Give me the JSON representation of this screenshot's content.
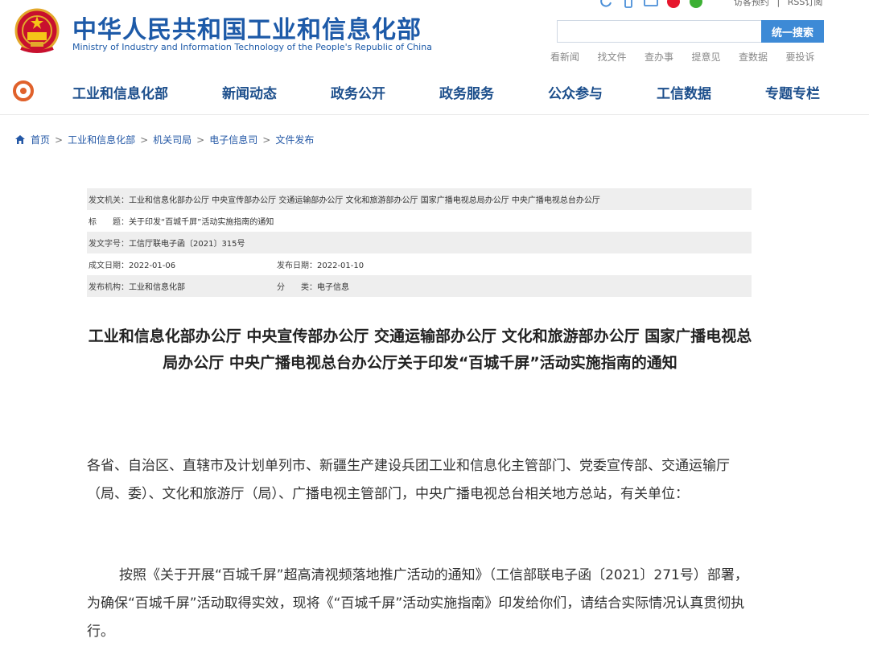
{
  "header": {
    "title": "中华人民共和国工业和信息化部",
    "subtitle": "Ministry of Industry and Information Technology of the People's Republic of China",
    "top_links": [
      "访客预约",
      "|",
      "RSS订阅"
    ],
    "search": {
      "placeholder": "",
      "button_label": "统一搜索"
    },
    "quick_links": [
      "看新闻",
      "找文件",
      "查办事",
      "提意见",
      "查数据",
      "要投诉"
    ]
  },
  "nav": {
    "items": [
      "工业和信息化部",
      "新闻动态",
      "政务公开",
      "政务服务",
      "公众参与",
      "工信数据",
      "专题专栏"
    ]
  },
  "breadcrumb": [
    "首页",
    "工业和信息化部",
    "机关司局",
    "电子信息司",
    "文件发布"
  ],
  "meta": {
    "issuer_label": "发文机关：",
    "issuer": "工业和信息化部办公厅 中央宣传部办公厅 交通运输部办公厅 文化和旅游部办公厅 国家广播电视总局办公厅 中央广播电视总台办公厅",
    "title_label": "标　　题：",
    "title": "关于印发“百城千屏”活动实施指南的通知",
    "docno_label": "发文字号：",
    "docno": "工信厅联电子函〔2021〕315号",
    "created_label": "成文日期：",
    "created": "2022-01-06",
    "published_label": "发布日期：",
    "published": "2022-01-10",
    "org_label": "发布机构：",
    "org": "工业和信息化部",
    "category_label": "分　　类：",
    "category": "电子信息"
  },
  "document": {
    "title": "工业和信息化部办公厅 中央宣传部办公厅 交通运输部办公厅 文化和旅游部办公厅 国家广播电视总局办公厅 中央广播电视总台办公厅关于印发“百城千屏”活动实施指南的通知",
    "salutation": "各省、自治区、直辖市及计划单列市、新疆生产建设兵团工业和信息化主管部门、党委宣传部、交通运输厅（局、委）、文化和旅游厅（局）、广播电视主管部门，中央广播电视总台相关地方总站，有关单位：",
    "paragraph1": "按照《关于开展“百城千屏”超高清视频落地推广活动的通知》（工信部联电子函〔2021〕271号）部署，为确保“百城千屏”活动取得实效，现将《“百城千屏”活动实施指南》印发给你们，请结合实际情况认真贯彻执行。"
  },
  "colors": {
    "brand_blue": "#1d5aa8",
    "nav_blue": "#1d4f8c",
    "search_button": "#3d8ad6",
    "meta_shade": "#eeeeee"
  }
}
